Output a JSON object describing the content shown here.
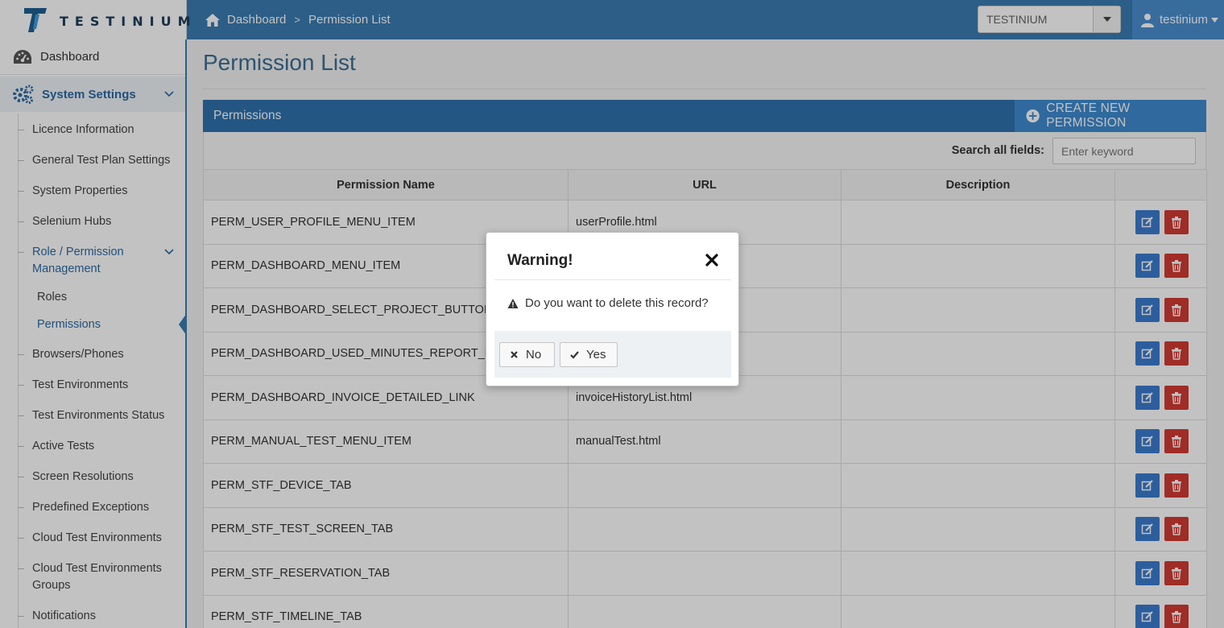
{
  "brand": {
    "name": "TESTINIUM"
  },
  "header": {
    "breadcrumb": [
      "Dashboard",
      "Permission List"
    ],
    "breadcrumb_separator": ">",
    "project_selected": "TESTINIUM",
    "user_name": "testinium"
  },
  "sidebar": {
    "dashboard": "Dashboard",
    "system_settings": "System Settings",
    "items": [
      "Licence Information",
      "General Test Plan Settings",
      "System Properties",
      "Selenium Hubs",
      "Role / Permission Management",
      "Browsers/Phones",
      "Test Environments",
      "Test Environments Status",
      "Active Tests",
      "Screen Resolutions",
      "Predefined Exceptions",
      "Cloud Test Environments",
      "Cloud Test Environments Groups",
      "Notifications"
    ],
    "role_items": [
      "Roles",
      "Permissions"
    ],
    "active_item": "Permissions"
  },
  "main": {
    "title": "Permission List",
    "panel_title": "Permissions",
    "create_button": "CREATE NEW PERMISSION",
    "search_label": "Search all fields:",
    "search_placeholder": "Enter keyword",
    "columns": [
      "Permission Name",
      "URL",
      "Description",
      ""
    ],
    "rows": [
      {
        "name": "PERM_USER_PROFILE_MENU_ITEM",
        "url": "userProfile.html",
        "description": ""
      },
      {
        "name": "PERM_DASHBOARD_MENU_ITEM",
        "url": "",
        "description": ""
      },
      {
        "name": "PERM_DASHBOARD_SELECT_PROJECT_BUTTON",
        "url": "",
        "description": ""
      },
      {
        "name": "PERM_DASHBOARD_USED_MINUTES_REPORT_LINK",
        "url": "",
        "description": ""
      },
      {
        "name": "PERM_DASHBOARD_INVOICE_DETAILED_LINK",
        "url": "invoiceHistoryList.html",
        "description": ""
      },
      {
        "name": "PERM_MANUAL_TEST_MENU_ITEM",
        "url": "manualTest.html",
        "description": ""
      },
      {
        "name": "PERM_STF_DEVICE_TAB",
        "url": "",
        "description": ""
      },
      {
        "name": "PERM_STF_TEST_SCREEN_TAB",
        "url": "",
        "description": ""
      },
      {
        "name": "PERM_STF_RESERVATION_TAB",
        "url": "",
        "description": ""
      },
      {
        "name": "PERM_STF_TIMELINE_TAB",
        "url": "",
        "description": ""
      }
    ]
  },
  "modal": {
    "title": "Warning!",
    "message": "Do you want to delete this record?",
    "no_label": "No",
    "yes_label": "Yes"
  },
  "colors": {
    "header_blue": "#3a7cb2",
    "accent_blue": "#3e8bd0",
    "delete_red": "#d33a32",
    "edit_blue": "#3a7cd0"
  }
}
